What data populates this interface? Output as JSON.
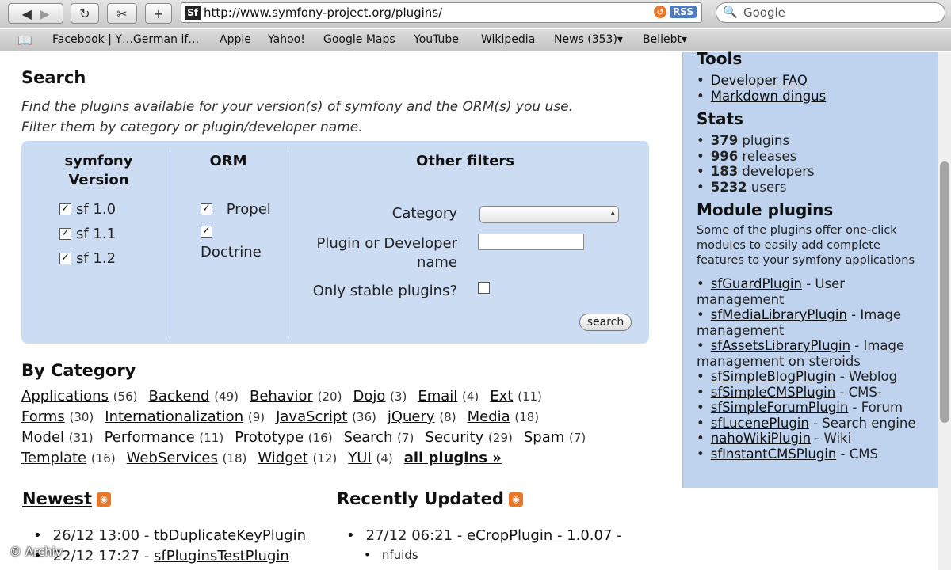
{
  "browser": {
    "url": "http://www.symfony-project.org/plugins/",
    "favicon_text": "Sf",
    "rss_label": "RSS",
    "search_placeholder": "Google"
  },
  "bookmarks": [
    "Facebook | Y…German if…",
    "Apple",
    "Yahoo!",
    "Google Maps",
    "YouTube",
    "Wikipedia",
    "News (353)▾",
    "Beliebt▾"
  ],
  "search": {
    "title": "Search",
    "intro_line1": "Find the plugins available for your version(s) of symfony and the ORM(s) you use.",
    "intro_line2": "Filter them by category or plugin/developer name.",
    "version_title_1": "symfony",
    "version_title_2": "Version",
    "versions": [
      "sf 1.0",
      "sf 1.1",
      "sf 1.2"
    ],
    "orm_title": "ORM",
    "orm_propel": "Propel",
    "orm_doctrine": "Doctrine",
    "other_title": "Other filters",
    "category_label": "Category",
    "plugin_label_1": "Plugin or Developer",
    "plugin_label_2": "name",
    "stable_label": "Only stable plugins?",
    "search_button": "search"
  },
  "categories": {
    "title": "By Category",
    "lines": [
      [
        {
          "name": "Applications",
          "count": "(56)"
        },
        {
          "name": "Backend",
          "count": "(49)"
        },
        {
          "name": "Behavior",
          "count": "(20)"
        },
        {
          "name": "Dojo",
          "count": "(3)"
        },
        {
          "name": "Email",
          "count": "(4)"
        },
        {
          "name": "Ext",
          "count": "(11)"
        }
      ],
      [
        {
          "name": "Forms",
          "count": "(30)"
        },
        {
          "name": "Internationalization",
          "count": "(9)"
        },
        {
          "name": "JavaScript",
          "count": "(36)"
        },
        {
          "name": "jQuery",
          "count": "(8)"
        },
        {
          "name": "Media",
          "count": "(18)"
        }
      ],
      [
        {
          "name": "Model",
          "count": "(31)"
        },
        {
          "name": "Performance",
          "count": "(11)"
        },
        {
          "name": "Prototype",
          "count": "(16)"
        },
        {
          "name": "Search",
          "count": "(7)"
        },
        {
          "name": "Security",
          "count": "(29)"
        },
        {
          "name": "Spam",
          "count": "(7)"
        }
      ],
      [
        {
          "name": "Template",
          "count": "(16)"
        },
        {
          "name": "WebServices",
          "count": "(18)"
        },
        {
          "name": "Widget",
          "count": "(12)"
        },
        {
          "name": "YUI",
          "count": "(4)"
        }
      ]
    ],
    "all_plugins": "all plugins »"
  },
  "newest": {
    "title": "Newest",
    "items": [
      {
        "date": "26/12 13:00",
        "sep": " - ",
        "name": "tbDuplicateKeyPlugin"
      },
      {
        "date": "22/12 17:27",
        "sep": " - ",
        "name": "sfPluginsTestPlugin"
      }
    ]
  },
  "recent": {
    "title": "Recently Updated",
    "items": [
      {
        "date": "27/12 06:21",
        "sep": " - ",
        "name": "eCropPlugin - 1.0.07",
        "tail": " -",
        "sub": "nfuids"
      }
    ]
  },
  "sidebar": {
    "tools_title": "Tools",
    "tools": [
      "Developer FAQ",
      "Markdown dingus"
    ],
    "stats_title": "Stats",
    "stats": [
      {
        "num": "379",
        "label": " plugins"
      },
      {
        "num": "996",
        "label": " releases"
      },
      {
        "num": "183",
        "label": " developers"
      },
      {
        "num": "5232",
        "label": " users"
      }
    ],
    "module_title": "Module plugins",
    "module_text": "Some of the plugins offer one-click modules to easily add complete features to your symfony applications",
    "modules": [
      {
        "name": "sfGuardPlugin",
        "desc": " - User management"
      },
      {
        "name": "sfMediaLibraryPlugin",
        "desc": " - Image management"
      },
      {
        "name": "sfAssetsLibraryPlugin",
        "desc": " - Image management on steroids"
      },
      {
        "name": "sfSimpleBlogPlugin",
        "desc": " - Weblog"
      },
      {
        "name": "sfSimpleCMSPlugin",
        "desc": " - CMS-"
      },
      {
        "name": "sfSimpleForumPlugin",
        "desc": " - Forum"
      },
      {
        "name": "sfLucenePlugin",
        "desc": " - Search engine"
      },
      {
        "name": "nahoWikiPlugin",
        "desc": " - Wiki"
      },
      {
        "name": "sfInstantCMSPlugin",
        "desc": " - CMS"
      }
    ]
  },
  "watermark": "© Archiv"
}
